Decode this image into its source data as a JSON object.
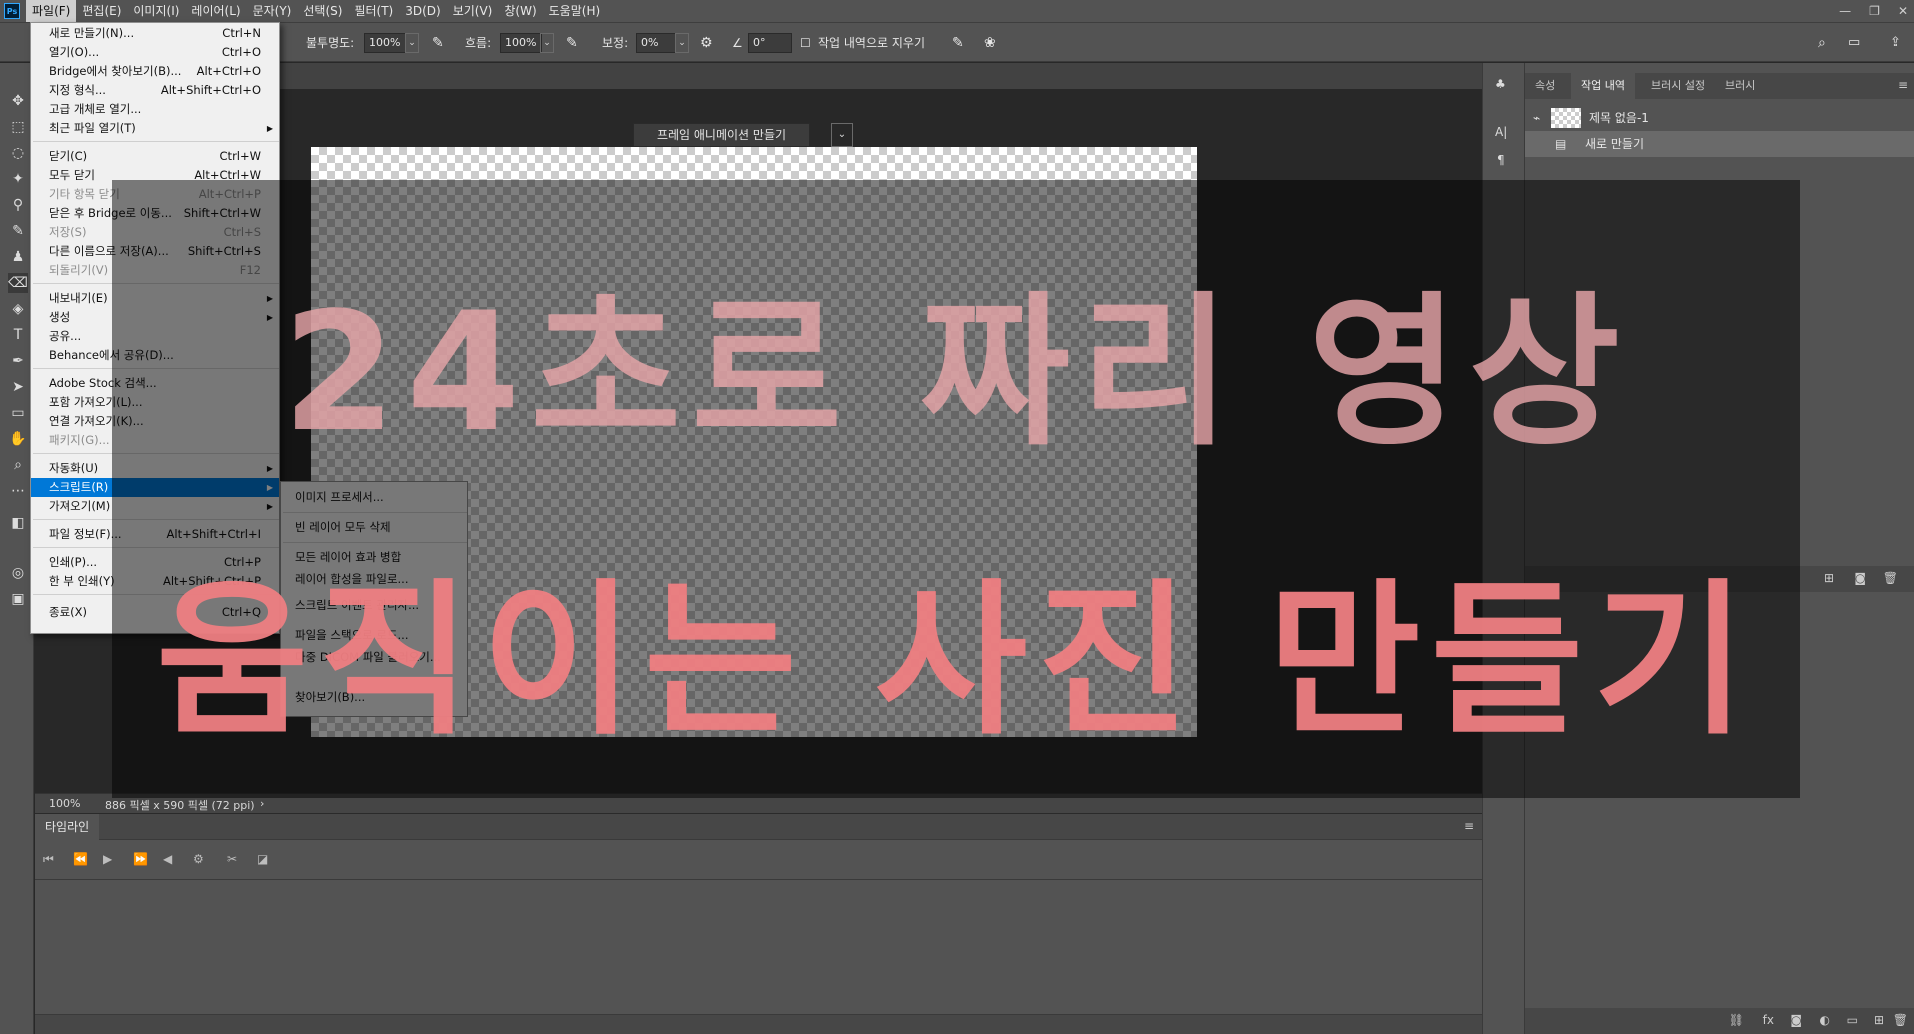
{
  "menubar": {
    "logo": "Ps",
    "items": [
      "파일(F)",
      "편집(E)",
      "이미지(I)",
      "레이어(L)",
      "문자(Y)",
      "선택(S)",
      "필터(T)",
      "3D(D)",
      "보기(V)",
      "창(W)",
      "도움말(H)"
    ],
    "window_controls": [
      "—",
      "❐",
      "✕"
    ]
  },
  "options": {
    "opacity_label": "불투명도:",
    "opacity_value": "100%",
    "flow_label": "흐름:",
    "flow_value": "100%",
    "smoothing_label": "보정:",
    "smoothing_value": "0%",
    "angle_value": "0°",
    "erase_history_label": "작업 내역으로 지우기"
  },
  "file_menu": {
    "items": [
      {
        "label": "새로 만들기(N)...",
        "shortcut": "Ctrl+N"
      },
      {
        "label": "열기(O)...",
        "shortcut": "Ctrl+O"
      },
      {
        "label": "Bridge에서 찾아보기(B)...",
        "shortcut": "Alt+Ctrl+O"
      },
      {
        "label": "지정 형식...",
        "shortcut": "Alt+Shift+Ctrl+O"
      },
      {
        "label": "고급 개체로 열기...",
        "shortcut": ""
      },
      {
        "label": "최근 파일 열기(T)",
        "shortcut": ""
      },
      {
        "label": "닫기(C)",
        "shortcut": "Ctrl+W"
      },
      {
        "label": "모두 닫기",
        "shortcut": "Alt+Ctrl+W"
      },
      {
        "label": "기타 항목 닫기",
        "shortcut": "Alt+Ctrl+P"
      },
      {
        "label": "닫은 후 Bridge로 이동...",
        "shortcut": "Shift+Ctrl+W"
      },
      {
        "label": "저장(S)",
        "shortcut": "Ctrl+S"
      },
      {
        "label": "다른 이름으로 저장(A)...",
        "shortcut": "Shift+Ctrl+S"
      },
      {
        "label": "되돌리기(V)",
        "shortcut": "F12"
      },
      {
        "label": "내보내기(E)",
        "shortcut": ""
      },
      {
        "label": "생성",
        "shortcut": ""
      },
      {
        "label": "공유...",
        "shortcut": ""
      },
      {
        "label": "Behance에서 공유(D)...",
        "shortcut": ""
      },
      {
        "label": "Adobe Stock 검색...",
        "shortcut": ""
      },
      {
        "label": "포함 가져오기(L)...",
        "shortcut": ""
      },
      {
        "label": "연결 가져오기(K)...",
        "shortcut": ""
      },
      {
        "label": "패키지(G)...",
        "shortcut": ""
      },
      {
        "label": "자동화(U)",
        "shortcut": ""
      },
      {
        "label": "스크립트(R)",
        "shortcut": ""
      },
      {
        "label": "가져오기(M)",
        "shortcut": ""
      },
      {
        "label": "파일 정보(F)...",
        "shortcut": "Alt+Shift+Ctrl+I"
      },
      {
        "label": "인쇄(P)...",
        "shortcut": "Ctrl+P"
      },
      {
        "label": "한 부 인쇄(Y)",
        "shortcut": "Alt+Shift+Ctrl+P"
      },
      {
        "label": "종료(X)",
        "shortcut": "Ctrl+Q"
      }
    ]
  },
  "scripts_submenu": {
    "items": [
      "이미지 프로세서...",
      "빈 레이어 모두 삭제",
      "모든 레이어 효과 병합",
      "레이어 합성을 파일로...",
      "스크립트 이벤트 관리자...",
      "파일을 스택으로 로드...",
      "다중 DICOM 파일 불러오기...",
      "찾아보기(B)..."
    ]
  },
  "status": {
    "zoom": "100%",
    "doc_info": "886 픽셀 x 590 픽셀 (72 ppi)",
    "arrow": "›"
  },
  "timeline": {
    "tab_label": "타임라인",
    "create_button": "프레임 애니메이션 만들기"
  },
  "right_panel": {
    "tabs": [
      "속성",
      "작업 내역",
      "브러시 설정",
      "브러시"
    ],
    "history_items": [
      "제목 없음-1",
      "새로 만들기"
    ]
  },
  "overlay": {
    "line1": "24초로 짜리 영상",
    "line2": "움직이는 사진 만들기"
  }
}
